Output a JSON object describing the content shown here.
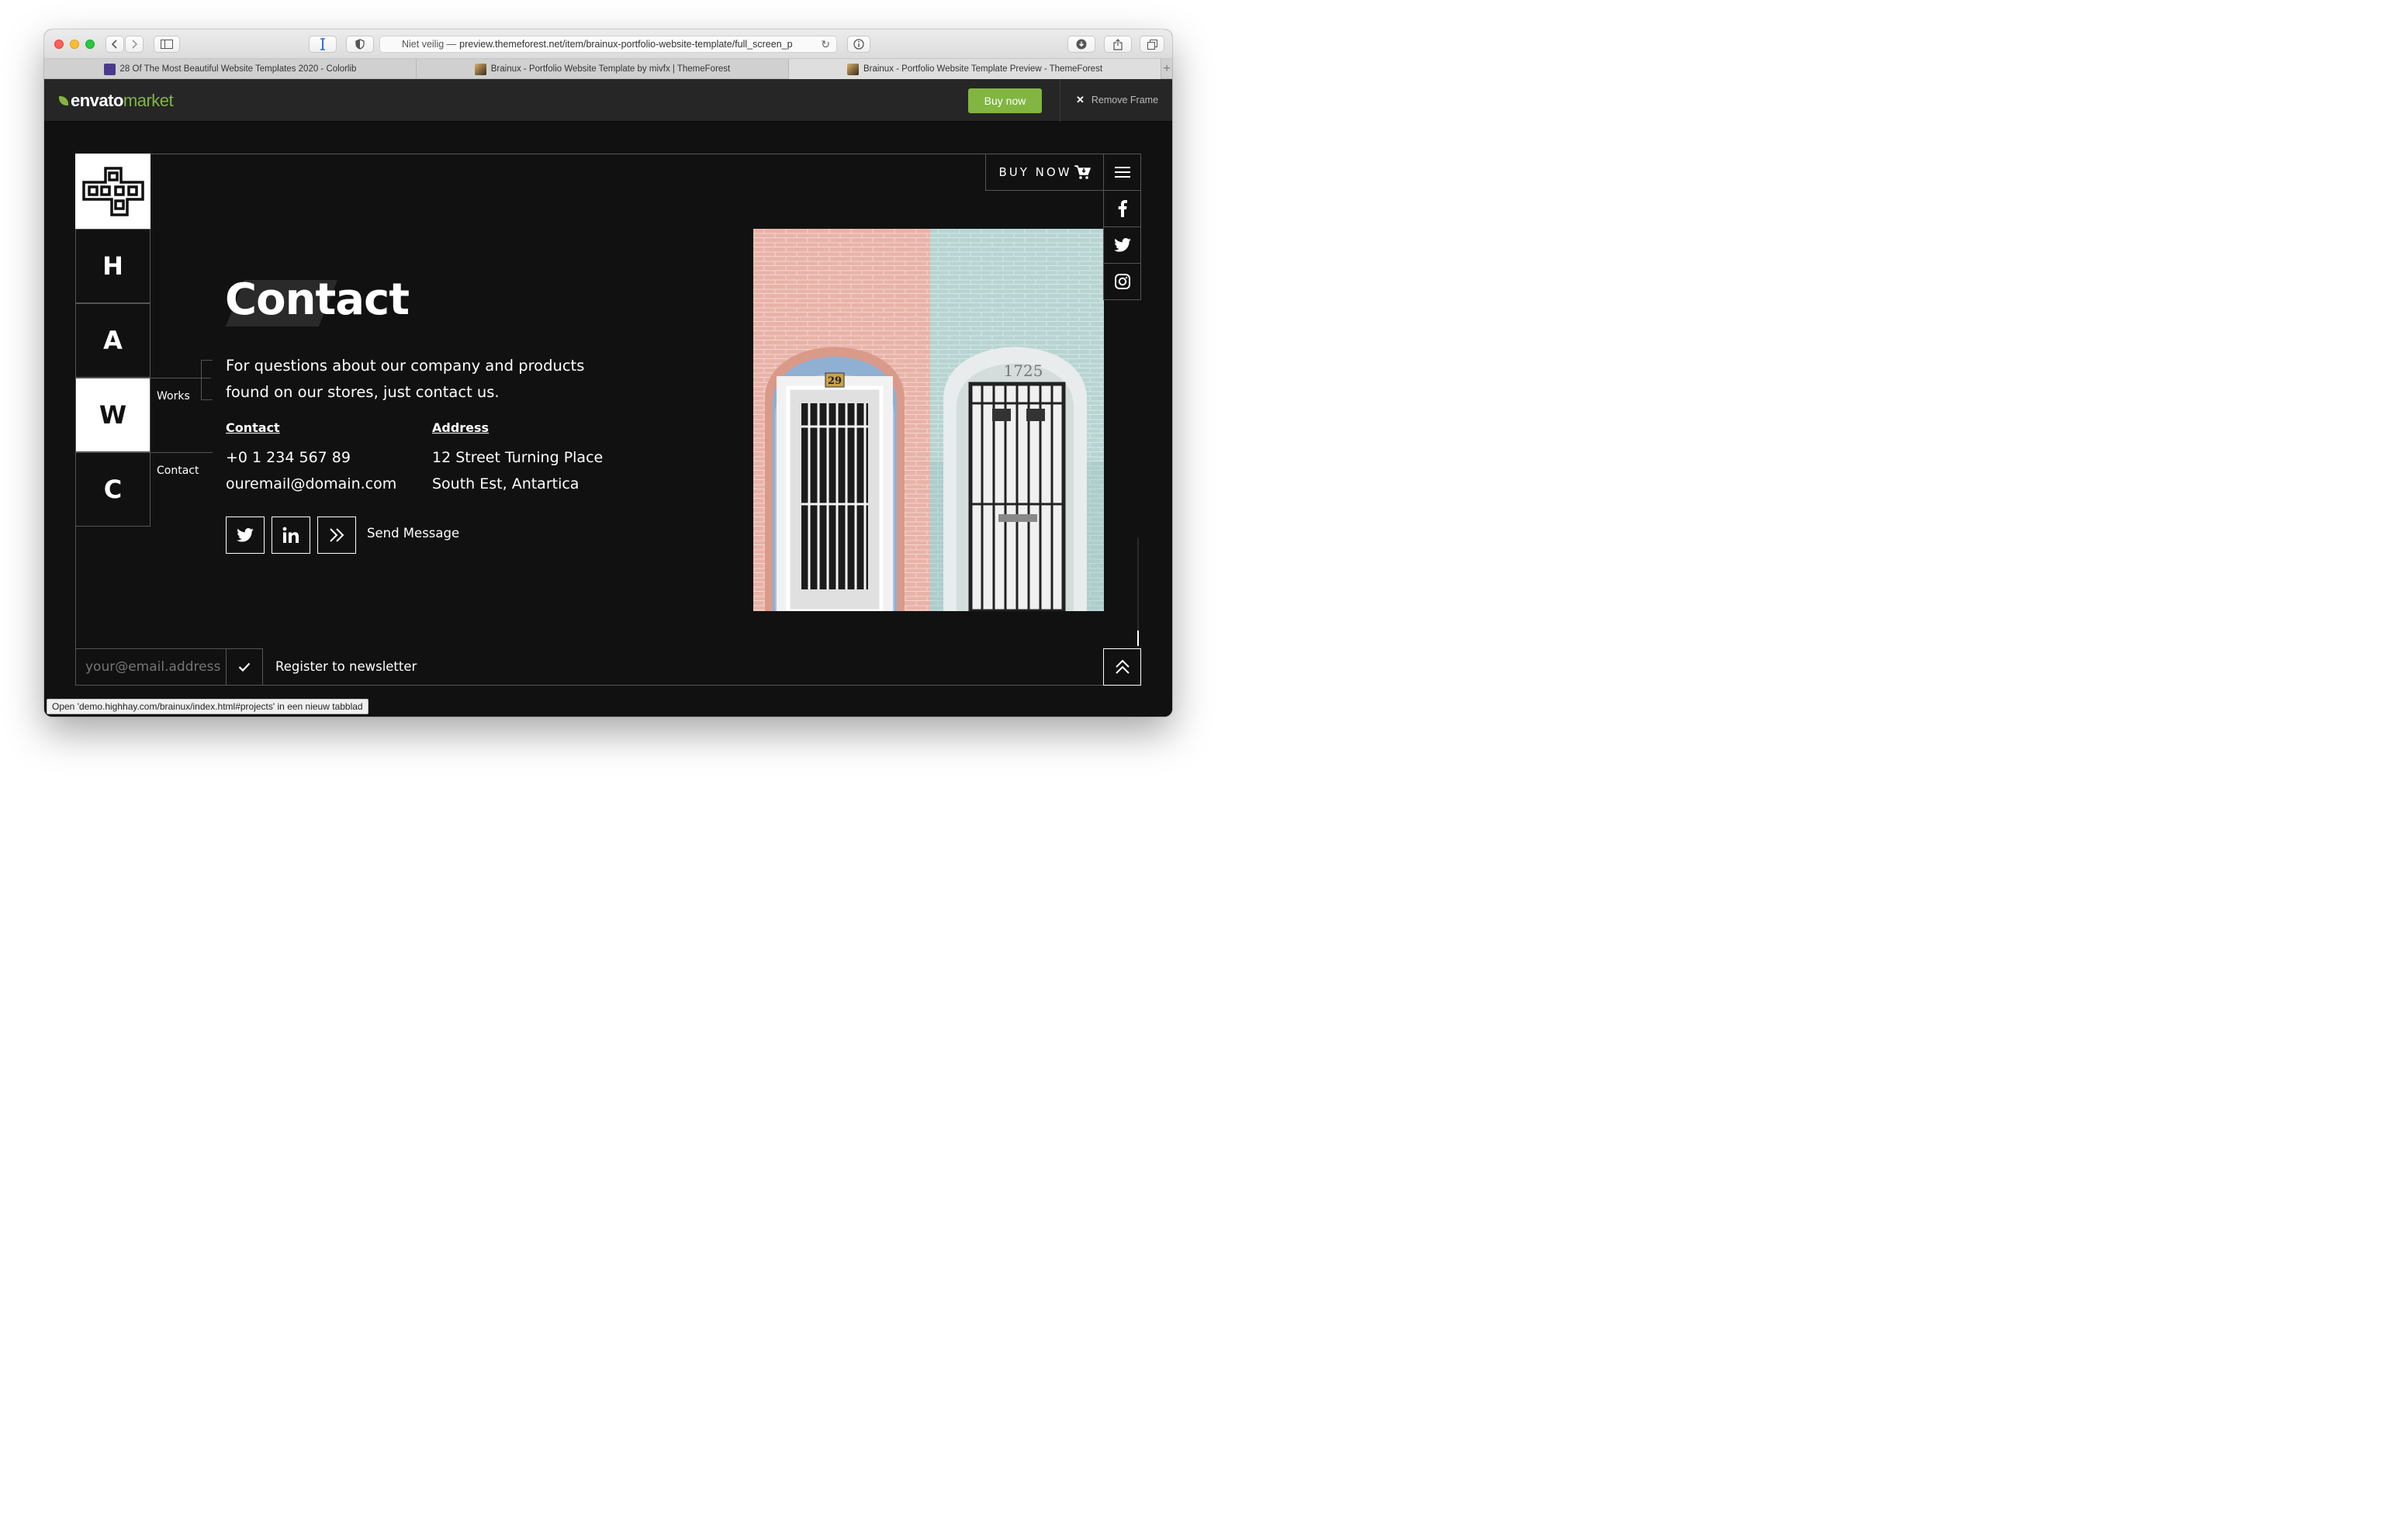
{
  "browser": {
    "address_prefix": "Niet veilig —",
    "address_url": "preview.themeforest.net/item/brainux-portfolio-website-template/full_screen_p",
    "tabs": [
      {
        "label": "28 Of The Most Beautiful Website Templates 2020 - Colorlib",
        "favicon": "colorlib"
      },
      {
        "label": "Brainux - Portfolio Website Template by mivfx | ThemeForest",
        "favicon": "themeforest"
      },
      {
        "label": "Brainux - Portfolio Website Template Preview - ThemeForest",
        "favicon": "themeforest"
      }
    ],
    "active_tab": 2,
    "status_text": "Open 'demo.highhay.com/brainux/index.html#projects' in een nieuw tabblad"
  },
  "envato": {
    "logo_primary": "envato",
    "logo_secondary": "market",
    "buy_label": "Buy now",
    "remove_label": "Remove Frame",
    "accent": "#82b541"
  },
  "site": {
    "nav": [
      {
        "letter": "H",
        "active": false
      },
      {
        "letter": "A",
        "active": false
      },
      {
        "letter": "W",
        "active": true
      },
      {
        "letter": "C",
        "active": false
      }
    ],
    "nav_labels": {
      "works": "Works",
      "contact": "Contact"
    },
    "title": "Contact",
    "lead": "For questions about our company and products found on our stores, just contact us.",
    "contact": {
      "heading": "Contact",
      "phone": "+0 1 234 567 89",
      "email": "ouremail@domain.com"
    },
    "address": {
      "heading": "Address",
      "line1": "12 Street Turning Place",
      "line2": "South Est, Antartica"
    },
    "send_label": "Send Message",
    "buy_now_label": "BUY NOW",
    "newsletter": {
      "placeholder": "your@email.address",
      "label": "Register to newsletter"
    },
    "photo": {
      "left_door_number": "29",
      "right_door_number": "1725"
    }
  }
}
